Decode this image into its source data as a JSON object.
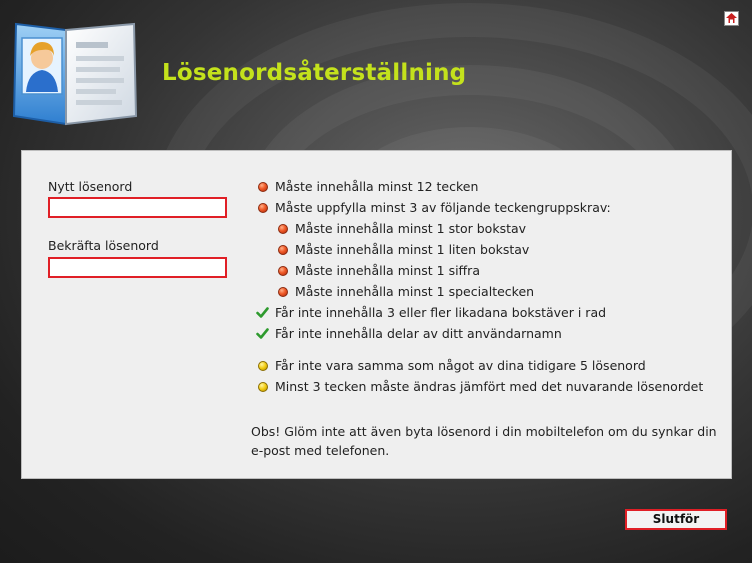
{
  "header": {
    "title": "Lösenordsåterställning",
    "help_icon": "help-icon"
  },
  "form": {
    "new_password_label": "Nytt lösenord",
    "new_password_value": "",
    "confirm_password_label": "Bekräfta lösenord",
    "confirm_password_value": ""
  },
  "requirements": [
    {
      "text": "Måste innehålla minst 12 tecken",
      "status": "red"
    },
    {
      "text": "Måste uppfylla minst 3 av följande teckengruppskrav:",
      "status": "red"
    },
    {
      "text": "Måste innehålla minst 1 stor bokstav",
      "status": "red"
    },
    {
      "text": "Måste innehålla minst 1 liten bokstav",
      "status": "red"
    },
    {
      "text": "Måste innehålla minst 1 siffra",
      "status": "red"
    },
    {
      "text": "Måste innehålla minst 1 specialtecken",
      "status": "red"
    },
    {
      "text": "Får inte innehålla 3 eller fler likadana bokstäver i rad",
      "status": "check"
    },
    {
      "text": "Får inte innehålla delar av ditt användarnamn",
      "status": "check"
    },
    {
      "text": "Får inte vara samma som något av dina tidigare 5 lösenord",
      "status": "yellow"
    },
    {
      "text": "Minst 3 tecken måste ändras jämfört med det nuvarande lösenordet",
      "status": "yellow"
    }
  ],
  "note": "Obs! Glöm inte att även byta lösenord i din mobiltelefon om du synkar din e-post med telefonen.",
  "footer": {
    "finish_label": "Slutför"
  },
  "colors": {
    "title": "#c4e21c",
    "field_border": "#e01f26",
    "status_red": "#f05a28",
    "status_yellow": "#f3cc12",
    "status_check": "#2e9a2e"
  }
}
